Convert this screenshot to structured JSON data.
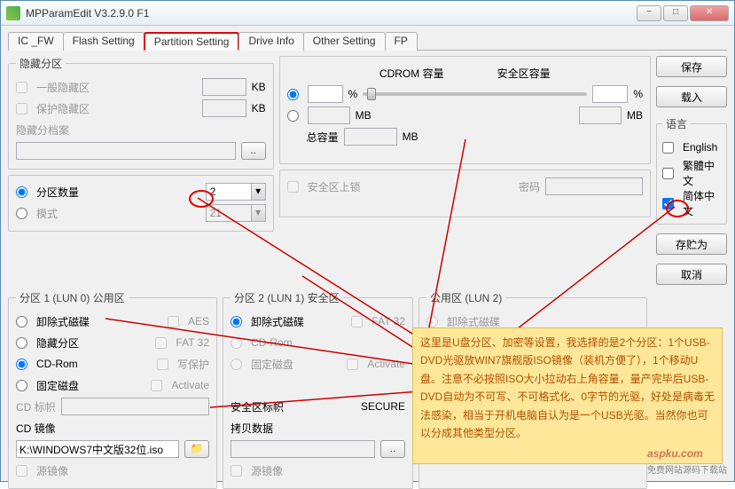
{
  "window": {
    "title": "MPParamEdit V3.2.9.0 F1"
  },
  "winbtns": {
    "min": "−",
    "max": "□",
    "close": "✕"
  },
  "tabs": [
    "IC _FW",
    "Flash Setting",
    "Partition Setting",
    "Drive Info",
    "Other Setting",
    "FP"
  ],
  "active_tab": 2,
  "hidden_partition": {
    "legend": "隐藏分区",
    "general_hidden": "一般隐藏区",
    "protect_hidden": "保护隐藏区",
    "archive_label": "隐藏分档案",
    "kb": "KB",
    "browse": ".."
  },
  "part_count": {
    "count_label": "分区数量",
    "count_value": "2",
    "mode_label": "模式",
    "mode_value": "21"
  },
  "capacity": {
    "cdrom_label": "CDROM 容量",
    "secure_label": "安全区容量",
    "pct": "%",
    "mb": "MB",
    "total_label": "总容量"
  },
  "sec_lock": {
    "lock_label": "安全区上锁",
    "pw_label": "密码"
  },
  "lun0": {
    "legend": "分区 1 (LUN 0) 公用区",
    "removable": "卸除式磁碟",
    "aes": "AES",
    "hidden": "隐藏分区",
    "fat32": "FAT 32",
    "cdrom": "CD-Rom",
    "wp": "写保护",
    "fixed": "固定磁盘",
    "activate": "Activate",
    "cd_label": "CD 标帜",
    "cd_image": "CD 镜像",
    "cd_path": "K:\\WINDOWS7中文版32位.iso",
    "src_image": "源镜像"
  },
  "lun1": {
    "legend": "分区 2 (LUN 1) 安全区",
    "removable": "卸除式磁碟",
    "fat32": "FAT 32",
    "cdrom": "CD-Rom",
    "fixed": "固定磁盘",
    "activate": "Activate",
    "sec_label": "安全区标帜",
    "sec_value": "SECURE",
    "copy_label": "拷贝数据",
    "src_image": "源镜像"
  },
  "lun2": {
    "legend": "公用区 (LUN 2)",
    "removable": "卸除式磁碟"
  },
  "sidebar": {
    "save": "保存",
    "load": "载入",
    "lang_label": "语言",
    "english": "English",
    "trad": "繁體中文",
    "simp": "简体中文",
    "saveas": "存贮为",
    "cancel": "取消"
  },
  "note_text": "这里是U盘分区、加密等设置，我选择的是2个分区：1个USB-DVD光驱放WIN7旗舰版ISO镜像（装机方便了），1个移动U盘。注意不必按照ISO大小拉动右上角容量，量产完毕后USB-DVD自动为不可写、不可格式化、0字节的光驱，好处是病毒无法感染，相当于开机电脑自认为是一个USB光驱。当然你也可以分成其他类型分区。",
  "watermark": {
    "brand": "aspku.com",
    "sub": "免费网站源码下载站"
  }
}
